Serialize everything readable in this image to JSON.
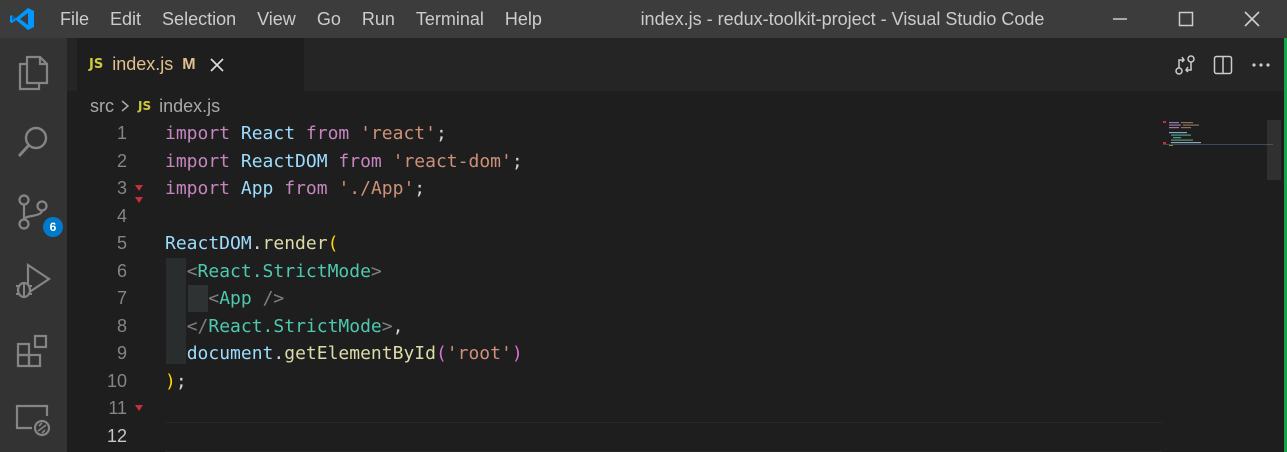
{
  "window": {
    "title": "index.js - redux-toolkit-project - Visual Studio Code",
    "menu": [
      "File",
      "Edit",
      "Selection",
      "View",
      "Go",
      "Run",
      "Terminal",
      "Help"
    ]
  },
  "activity_bar": {
    "icons": [
      "explorer-icon",
      "search-icon",
      "source-control-icon",
      "run-debug-icon",
      "extensions-icon",
      "remote-explorer-icon"
    ],
    "source_control_badge": "6"
  },
  "tab": {
    "badge": "JS",
    "filename": "index.js",
    "status": "M"
  },
  "breadcrumb": {
    "folder": "src",
    "badge": "JS",
    "file": "index.js"
  },
  "code": {
    "active_line": 12,
    "lines": [
      {
        "n": "1"
      },
      {
        "n": "2"
      },
      {
        "n": "3"
      },
      {
        "n": "4"
      },
      {
        "n": "5"
      },
      {
        "n": "6"
      },
      {
        "n": "7"
      },
      {
        "n": "8"
      },
      {
        "n": "9"
      },
      {
        "n": "10"
      },
      {
        "n": "11"
      },
      {
        "n": "12"
      }
    ]
  },
  "colors": {
    "keyword": "#c586c0",
    "identifier": "#9cdcfe",
    "string": "#ce9178",
    "tag": "#4ec9b0",
    "accent": "#007acc"
  }
}
